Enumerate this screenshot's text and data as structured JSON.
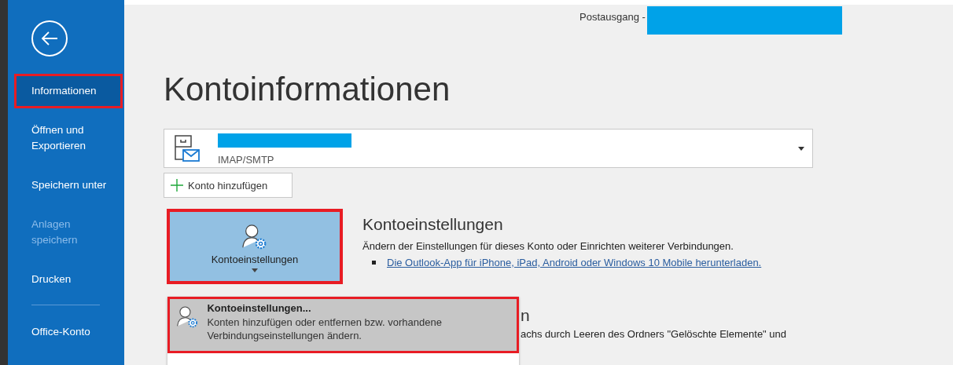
{
  "sidebar": {
    "items": [
      {
        "label": "Informationen",
        "selected": true,
        "disabled": false,
        "highlighted": true
      },
      {
        "label": "Öffnen und Exportieren",
        "selected": false,
        "disabled": false,
        "highlighted": false
      },
      {
        "label": "Speichern unter",
        "selected": false,
        "disabled": false,
        "highlighted": false
      },
      {
        "label": "Anlagen speichern",
        "selected": false,
        "disabled": true,
        "highlighted": false
      },
      {
        "label": "Drucken",
        "selected": false,
        "disabled": false,
        "highlighted": false
      },
      {
        "label": "Office-Konto",
        "selected": false,
        "disabled": false,
        "highlighted": false
      }
    ]
  },
  "window": {
    "title": "Postausgang -"
  },
  "heading": "Kontoinformationen",
  "account": {
    "type": "IMAP/SMTP"
  },
  "add_account_button": "Konto hinzufügen",
  "account_settings": {
    "button": {
      "label": "Kontoeinstellungen",
      "highlighted": true
    },
    "title": "Kontoeinstellungen",
    "description": "Ändern der Einstellungen für dieses Konto oder Einrichten weiterer Verbindungen.",
    "link": "Die Outlook-App für iPhone, iPad, Android oder Windows 10 Mobile herunterladen."
  },
  "menu": {
    "items": [
      {
        "title": "Kontoeinstellungen...",
        "description": "Konten hinzufügen oder entfernen bzw. vorhandene Verbindungseinstellungen ändern.",
        "highlighted": true
      }
    ]
  },
  "cleanup": {
    "title": "n",
    "description": "achs durch Leeren des Ordners \"Gelöschte Elemente\" und"
  }
}
